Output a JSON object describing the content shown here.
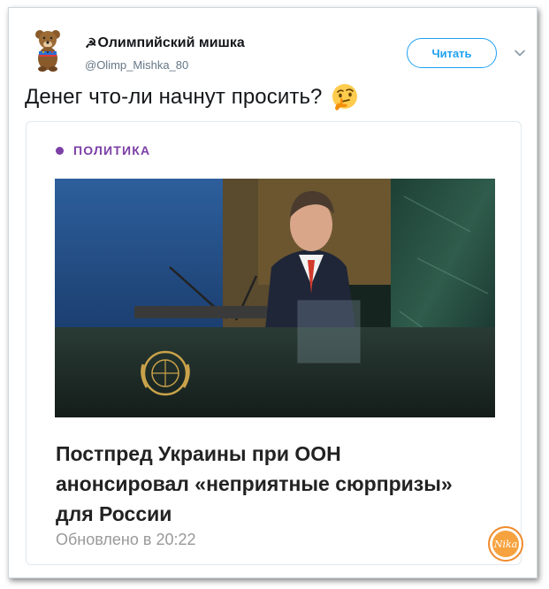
{
  "tweet": {
    "author": {
      "display_name": "Олимпийский мишка",
      "name_prefix_glyph": "☭",
      "handle": "@Olimp_Mishka_80",
      "avatar_icon": "olympic-bear-icon"
    },
    "follow_label": "Читать",
    "text": "Денег что-ли начнут просить?",
    "emoji": "thinking-face-emoji"
  },
  "card": {
    "category": "ПОЛИТИКА",
    "category_color": "#7b3fa6",
    "image_icon": "un-assembly-speaker-photo",
    "headline_lines": [
      "Постпред Украины при ООН",
      "анонсировал «неприятные сюрпризы»",
      "для России"
    ],
    "updated": "Обновлено в 20:22"
  },
  "watermark": {
    "text": "Nika",
    "color": "#f08a2c"
  },
  "colors": {
    "accent": "#1da1f2",
    "text": "#14171a",
    "muted": "#657786"
  }
}
